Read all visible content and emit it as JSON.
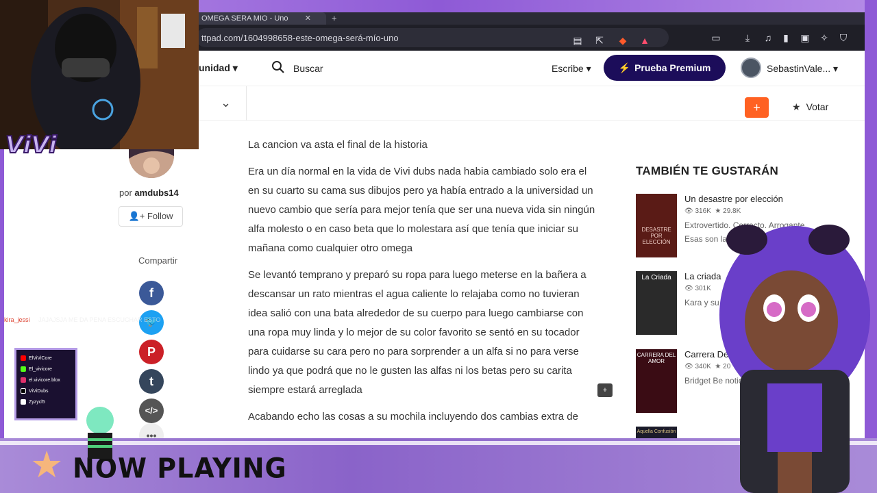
{
  "browser": {
    "tab_title": "OMEGA SERA MIO - Uno",
    "url": "ttpad.com/1604998658-este-omega-será-mío-uno"
  },
  "header": {
    "nav_comunidad": "unidad",
    "search_label": "Buscar",
    "escribe_label": "Escribe",
    "premium_label": "Prueba Premium",
    "username": "SebastinVale..."
  },
  "story_bar": {
    "add_label": "+",
    "vote_label": "Votar"
  },
  "author": {
    "by_prefix": "por",
    "name": "amdubs14",
    "follow_label": "Follow"
  },
  "share": {
    "label": "Compartir",
    "networks": [
      "facebook",
      "twitter",
      "pinterest",
      "tumblr",
      "embed",
      "more"
    ]
  },
  "story": {
    "paragraphs": [
      "La cancion va asta el final de la historia",
      "Era un día normal en la vida de Vivi dubs nada habia cambiado solo era el en su cuarto su cama sus dibujos pero ya había entrado a la universidad un nuevo cambio que sería para mejor tenía que ser una nueva vida sin ningún alfa molesto o en caso beta que lo molestara así que tenía que iniciar su mañana como cualquier otro omega",
      "Se levantó temprano y preparó su ropa para luego meterse en la bañera a descansar un rato mientras el agua caliente lo relajaba como no tuvieran idea salió con una bata alrededor de su cuerpo para luego cambiarse con una ropa muy linda y lo mejor de su color favorito se sentó en su tocador para cuidarse su cara pero no para sorprender a un alfa si no para verse lindo ya que podrá que no le gusten las alfas ni los betas pero su carita siempre estará arreglada",
      "Acabando echo las cosas a su mochila incluyendo dos cambias extra de"
    ]
  },
  "recommendations": {
    "title": "TAMBIÉN TE GUSTARÁN",
    "items": [
      {
        "name": "Un desastre por elección",
        "reads": "316K",
        "votes": "29.8K",
        "desc": "Extrovertido. Correcto. Arrogante. Esas son las",
        "cover_color": "#5a1b16",
        "cover_text": "DESASTRE POR ELECCIÓN"
      },
      {
        "name": "La criada",
        "reads": "301K",
        "votes": "",
        "desc": "Kara y su una a la ot",
        "cover_color": "#2a2a2a",
        "cover_text": "La Criada"
      },
      {
        "name": "Carrera Del Amor",
        "reads": "340K",
        "votes": "20",
        "desc": "Bridget Be noticias im",
        "cover_color": "#3a0c14",
        "cover_text": "CARRERA DEL AMOR"
      },
      {
        "name": "",
        "reads": "",
        "votes": "",
        "desc": "",
        "cover_color": "#1b1b2a",
        "cover_text": "Aquella Confusión"
      }
    ]
  },
  "overlay": {
    "chat_user": "kira_jessi",
    "chat_message": "JAJAJSJA ME DA PENA ESCUCHAR ESTO",
    "brand": "ViVi",
    "socials": [
      "ElViViCore",
      "El_vivicore",
      "el.vivicore.blox",
      "ViViDubs",
      "Zyzycl5"
    ],
    "now_playing": "NOW PLAYING"
  },
  "colors": {
    "wattpad_orange": "#ff6122",
    "premium_navy": "#1c0d5a",
    "overlay_purple": "#8a63c9"
  }
}
